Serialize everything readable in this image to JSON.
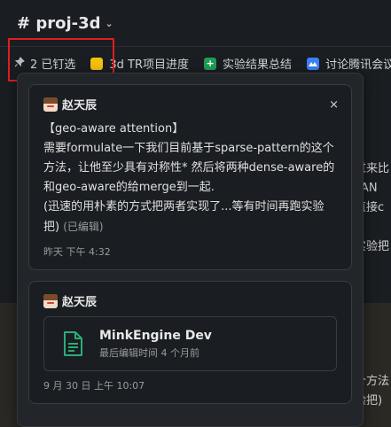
{
  "header": {
    "channel": "# proj-3d",
    "chevron": "⌄"
  },
  "bookmarks": {
    "pinned": "2 已钉选",
    "items": [
      {
        "label": "3d TR项目进度",
        "icon": "folder-icon",
        "color": "#f4c20d"
      },
      {
        "label": "实验结果总结",
        "icon": "sheet-icon",
        "color": "#1e9e57",
        "glyph": "+"
      },
      {
        "label": "讨论腾讯会议",
        "icon": "meeting-icon",
        "color": "#3b82f6"
      }
    ]
  },
  "background": {
    "line1": "过来比",
    "line2": "TAN",
    "line3": "直接c",
    "line4": "实验把",
    "line5": "个方法",
    "line6": "验把)"
  },
  "popover": {
    "pin1": {
      "author": "赵天辰",
      "close": "×",
      "text1": "【geo-aware attention】",
      "text2": "需要formulate一下我们目前基于sparse-pattern的这个方法，让他至少具有对称性* 然后将两种dense-aware的和geo-aware的给merge到一起.",
      "text3": "(迅速的用朴素的方式把两者实现了...等有时间再跑实验把)",
      "edited": "(已编辑)",
      "time": "昨天 下午 4:32"
    },
    "pin2": {
      "author": "赵天辰",
      "canvas_title": "MinkEngine Dev",
      "canvas_sub": "最后编辑时间 4 个月前",
      "time": "9 月 30 日 上午 10:07"
    }
  }
}
